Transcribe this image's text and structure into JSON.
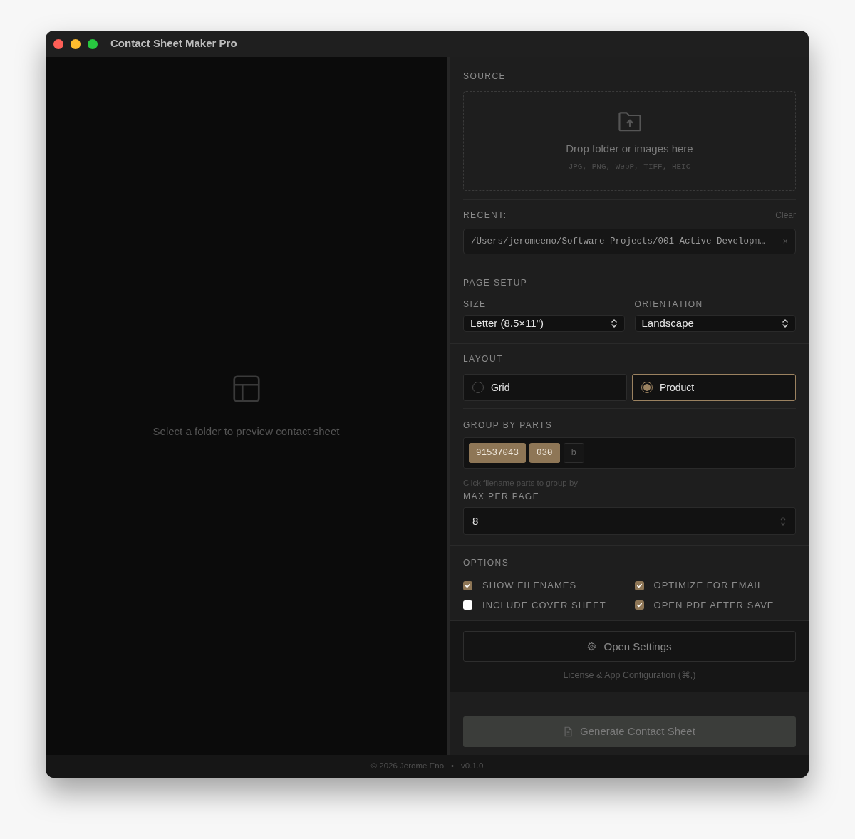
{
  "window": {
    "title": "Contact Sheet Maker Pro"
  },
  "preview": {
    "empty_message": "Select a folder to preview contact sheet"
  },
  "source": {
    "label": "SOURCE",
    "drop_title": "Drop folder or images here",
    "drop_formats": "JPG, PNG, WebP, TIFF, HEIC",
    "recent_label": "RECENT:",
    "clear": "Clear",
    "recent_path": "/Users/jeromeeno/Software Projects/001 Active Developm…",
    "remove": "×"
  },
  "page_setup": {
    "label": "PAGE SETUP",
    "size_label": "SIZE",
    "size_value": "Letter (8.5×11\")",
    "orientation_label": "ORIENTATION",
    "orientation_value": "Landscape"
  },
  "layout": {
    "label": "LAYOUT",
    "options": [
      {
        "label": "Grid",
        "selected": false
      },
      {
        "label": "Product",
        "selected": true
      }
    ]
  },
  "group_by": {
    "label": "GROUP BY PARTS",
    "parts": [
      {
        "label": "91537043",
        "selected": true
      },
      {
        "label": "030",
        "selected": true
      },
      {
        "label": "b",
        "selected": false
      }
    ],
    "hint": "Click filename parts to group by"
  },
  "max_per_page": {
    "label": "MAX PER PAGE",
    "value": "8"
  },
  "options": {
    "label": "OPTIONS",
    "items": [
      {
        "label": "SHOW FILENAMES",
        "checked": true
      },
      {
        "label": "OPTIMIZE FOR EMAIL",
        "checked": true
      },
      {
        "label": "INCLUDE COVER SHEET",
        "checked": false
      },
      {
        "label": "OPEN PDF AFTER SAVE",
        "checked": true
      }
    ]
  },
  "settings": {
    "button": "Open Settings",
    "caption": "License & App Configuration (⌘,)"
  },
  "generate": {
    "button": "Generate Contact Sheet"
  },
  "footer": {
    "copyright": "© 2026 Jerome Eno",
    "separator": "•",
    "version": "v0.1.0"
  }
}
